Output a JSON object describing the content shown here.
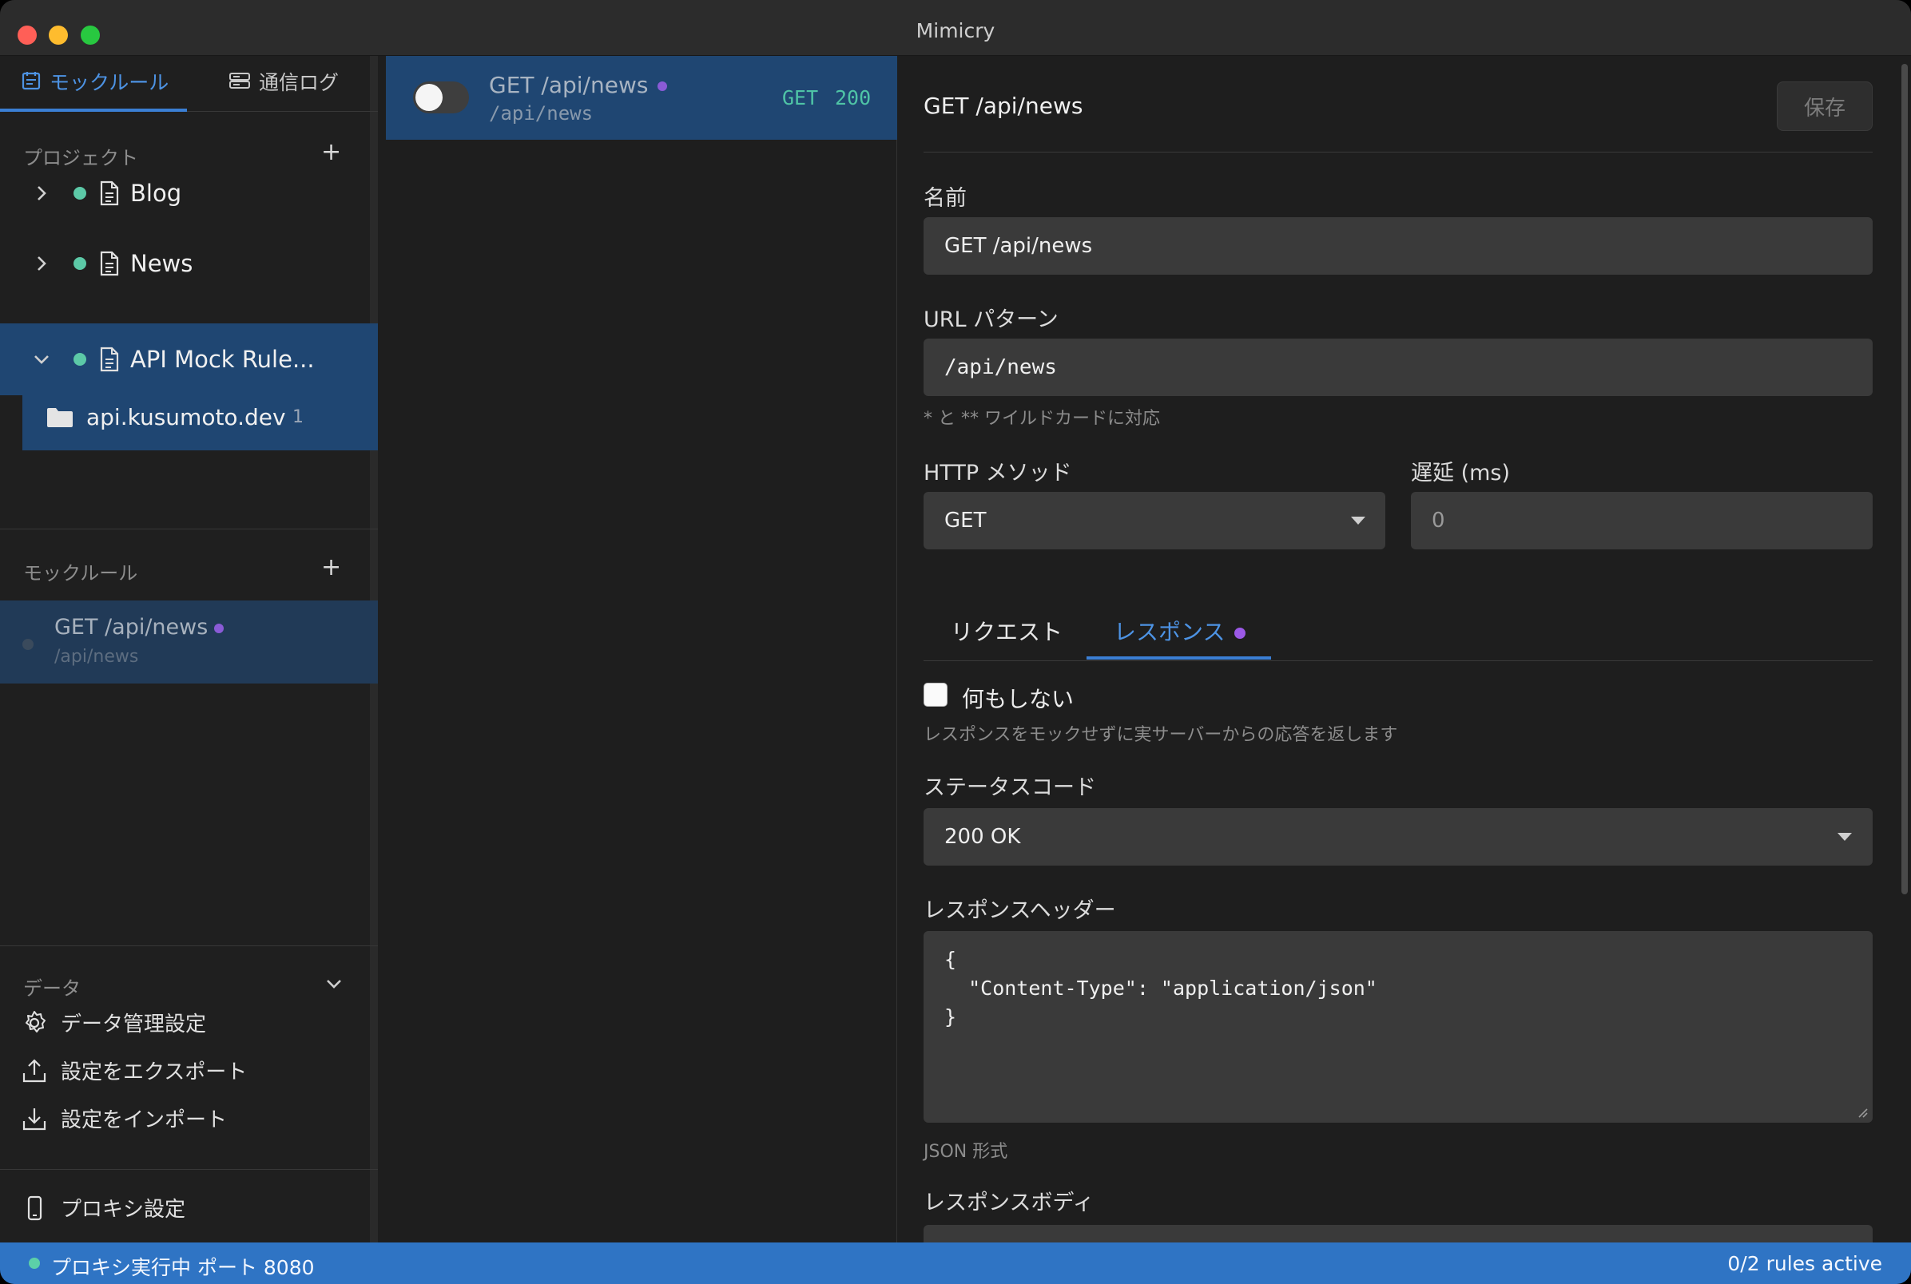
{
  "window": {
    "title": "Mimicry"
  },
  "sidebar": {
    "tabs": [
      {
        "label": "モックルール",
        "icon": "calendar-list-icon",
        "active": true
      },
      {
        "label": "通信ログ",
        "icon": "server-log-icon",
        "active": false
      }
    ],
    "projects_header": "プロジェクト",
    "projects": [
      {
        "name": "Blog",
        "expanded": false
      },
      {
        "name": "News",
        "expanded": false
      },
      {
        "name": "API Mock Rule...",
        "expanded": true
      }
    ],
    "folder": {
      "name": "api.kusumoto.dev",
      "count": "1"
    },
    "rules_header": "モックルール",
    "rules": [
      {
        "name": "GET /api/news",
        "url": "/api/news"
      }
    ],
    "data_header": "データ",
    "data_items": [
      {
        "label": "データ管理設定",
        "icon": "gear-icon"
      },
      {
        "label": "設定をエクスポート",
        "icon": "upload-icon"
      },
      {
        "label": "設定をインポート",
        "icon": "download-icon"
      }
    ],
    "proxy_settings": "プロキシ設定"
  },
  "middle": {
    "rule": {
      "name": "GET /api/news",
      "url": "/api/news",
      "method": "GET",
      "status": "200",
      "enabled": false
    }
  },
  "editor": {
    "title": "GET /api/news",
    "save_label": "保存",
    "name_label": "名前",
    "name_value": "GET /api/news",
    "url_label": "URL パターン",
    "url_value": "/api/news",
    "url_hint": "* と ** ワイルドカードに対応",
    "method_label": "HTTP メソッド",
    "method_value": "GET",
    "delay_label": "遅延 (ms)",
    "delay_value": "0",
    "tabs": {
      "request": "リクエスト",
      "response": "レスポンス"
    },
    "noop_label": "何もしない",
    "noop_hint": "レスポンスをモックせずに実サーバーからの応答を返します",
    "status_label": "ステータスコード",
    "status_value": "200 OK",
    "headers_label": "レスポンスヘッダー",
    "headers_value": "{\n  \"Content-Type\": \"application/json\"\n}",
    "headers_hint": "JSON 形式",
    "body_label": "レスポンスボディ"
  },
  "statusbar": {
    "left": "プロキシ実行中 ポート 8080",
    "right": "0/2 rules active"
  },
  "colors": {
    "accent": "#3b7fd4",
    "selected": "#1f4672",
    "status_bar": "#2f74c4",
    "project_dot": "#5cc9a7",
    "modified_dot": "#9b59e6"
  }
}
